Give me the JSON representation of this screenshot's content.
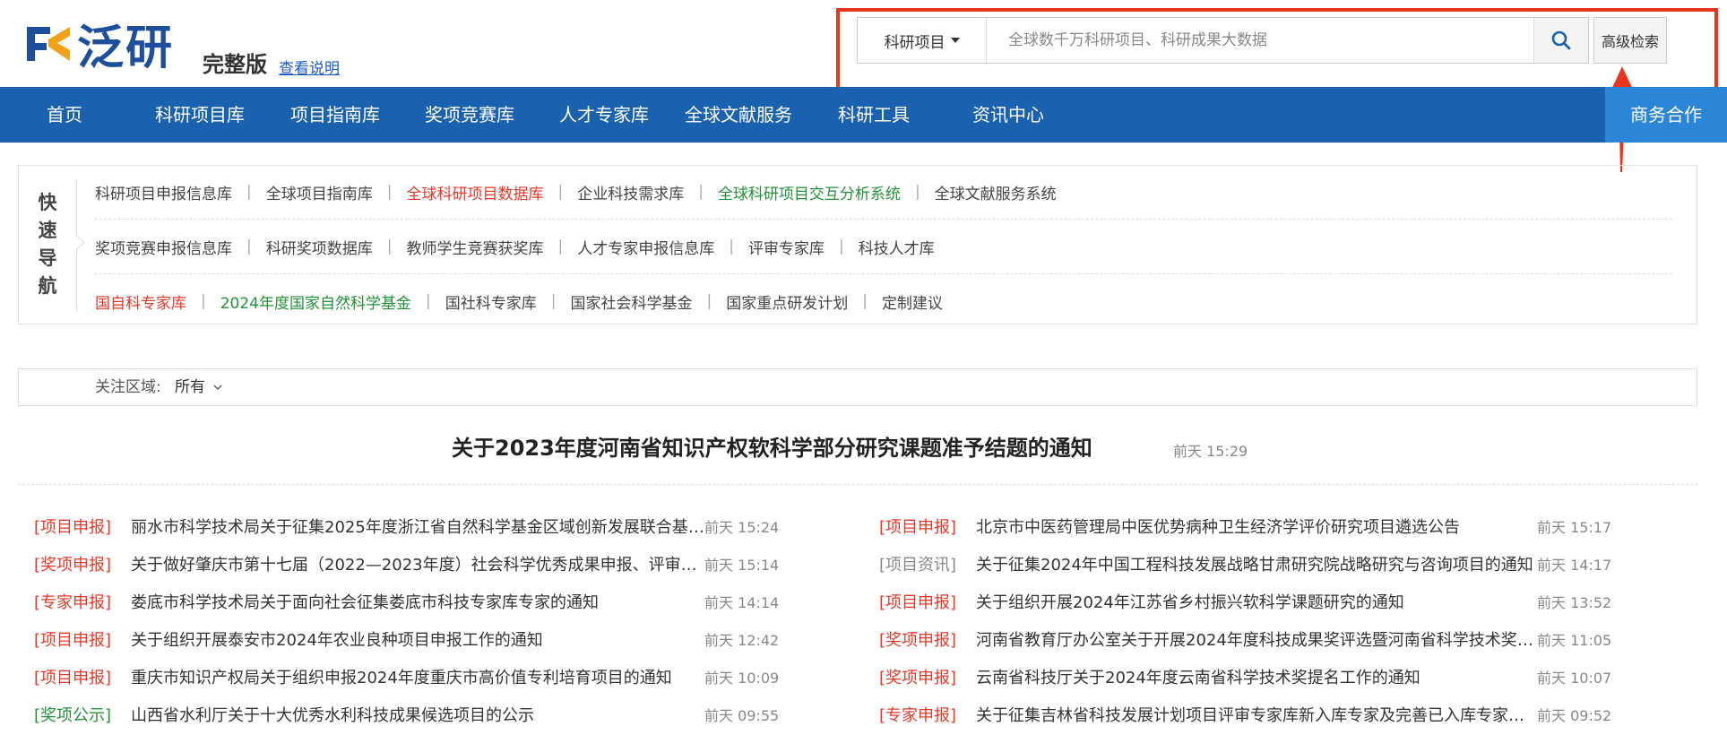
{
  "header": {
    "logo_text": "泛研",
    "edition": "完整版",
    "howto_link": "查看说明",
    "search": {
      "category": "科研项目",
      "placeholder": "全球数千万科研项目、科研成果大数据",
      "advanced_label": "高级检索"
    }
  },
  "nav": {
    "items": [
      "首页",
      "科研项目库",
      "项目指南库",
      "奖项竞赛库",
      "人才专家库",
      "全球文献服务",
      "科研工具",
      "资讯中心"
    ],
    "business": "商务合作"
  },
  "quick_nav": {
    "label": [
      "快",
      "速",
      "导",
      "航"
    ],
    "rows": [
      [
        {
          "text": "科研项目申报信息库",
          "color": "#444"
        },
        {
          "text": "全球项目指南库",
          "color": "#444"
        },
        {
          "text": "全球科研项目数据库",
          "color": "#e63828"
        },
        {
          "text": "企业科技需求库",
          "color": "#444"
        },
        {
          "text": "全球科研项目交互分析系统",
          "color": "#23913a"
        },
        {
          "text": "全球文献服务系统",
          "color": "#444"
        }
      ],
      [
        {
          "text": "奖项竞赛申报信息库",
          "color": "#444"
        },
        {
          "text": "科研奖项数据库",
          "color": "#444"
        },
        {
          "text": "教师学生竞赛获奖库",
          "color": "#444"
        },
        {
          "text": "人才专家申报信息库",
          "color": "#444"
        },
        {
          "text": "评审专家库",
          "color": "#444"
        },
        {
          "text": "科技人才库",
          "color": "#444"
        }
      ],
      [
        {
          "text": "国自科专家库",
          "color": "#e63828"
        },
        {
          "text": "2024年度国家自然科学基金",
          "color": "#23913a"
        },
        {
          "text": "国社科专家库",
          "color": "#444"
        },
        {
          "text": "国家社会科学基金",
          "color": "#444"
        },
        {
          "text": "国家重点研发计划",
          "color": "#444"
        },
        {
          "text": "定制建议",
          "color": "#444"
        }
      ]
    ]
  },
  "region": {
    "label": "关注区域:",
    "value": "所有"
  },
  "headline": {
    "title": "关于2023年度河南省知识产权软科学部分研究课题准予结题的通知",
    "time": "前天 15:29"
  },
  "news_left": [
    {
      "tag": "[项目申报]",
      "tag_color": "#e63828",
      "title": "丽水市科学技术局关于征集2025年度浙江省自然科学基金区域创新发展联合基金指南建议的通知",
      "time": "前天 15:24"
    },
    {
      "tag": "[奖项申报]",
      "tag_color": "#e63828",
      "title": "关于做好肇庆市第十七届（2022—2023年度）社会科学优秀成果申报、评审工作的通知",
      "time": "前天 15:14"
    },
    {
      "tag": "[专家申报]",
      "tag_color": "#e63828",
      "title": "娄底市科学技术局关于面向社会征集娄底市科技专家库专家的通知",
      "time": "前天 14:14"
    },
    {
      "tag": "[项目申报]",
      "tag_color": "#e63828",
      "title": "关于组织开展泰安市2024年农业良种项目申报工作的通知",
      "time": "前天 12:42"
    },
    {
      "tag": "[项目申报]",
      "tag_color": "#e63828",
      "title": "重庆市知识产权局关于组织申报2024年度重庆市高价值专利培育项目的通知",
      "time": "前天 10:09"
    },
    {
      "tag": "[奖项公示]",
      "tag_color": "#23913a",
      "title": "山西省水利厅关于十大优秀水利科技成果候选项目的公示",
      "time": "前天 09:55"
    }
  ],
  "news_right": [
    {
      "tag": "[项目申报]",
      "tag_color": "#e63828",
      "title": "北京市中医药管理局中医优势病种卫生经济学评价研究项目遴选公告",
      "time": "前天 15:17"
    },
    {
      "tag": "[项目资讯]",
      "tag_color": "#888888",
      "title": "关于征集2024年中国工程科技发展战略甘肃研究院战略研究与咨询项目的通知",
      "time": "前天 14:17"
    },
    {
      "tag": "[项目申报]",
      "tag_color": "#e63828",
      "title": "关于组织开展2024年江苏省乡村振兴软科学课题研究的通知",
      "time": "前天 13:52"
    },
    {
      "tag": "[奖项申报]",
      "tag_color": "#e63828",
      "title": "河南省教育厅办公室关于开展2024年度科技成果奖评选暨河南省科学技术奖推荐工作的通知",
      "time": "前天 11:05"
    },
    {
      "tag": "[奖项申报]",
      "tag_color": "#e63828",
      "title": "云南省科技厅关于2024年度云南省科学技术奖提名工作的通知",
      "time": "前天 10:07"
    },
    {
      "tag": "[专家申报]",
      "tag_color": "#e63828",
      "title": "关于征集吉林省科技发展计划项目评审专家库新入库专家及完善已入库专家信息的通知",
      "time": "前天 09:52"
    }
  ]
}
